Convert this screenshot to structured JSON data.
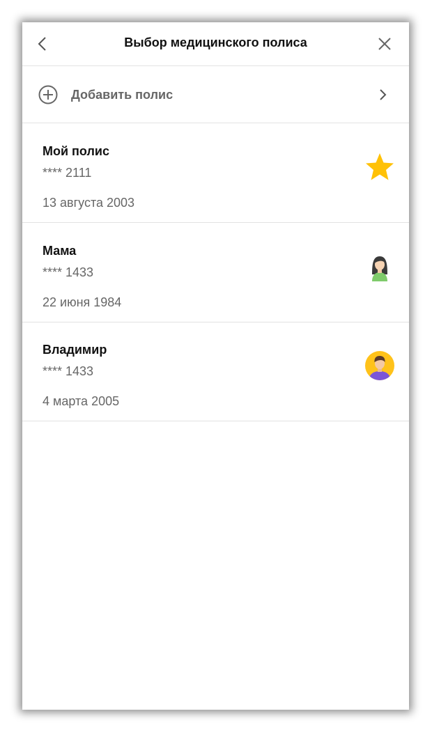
{
  "header": {
    "title": "Выбор медицинского полиса",
    "back_icon": "chevron-left-icon",
    "close_icon": "close-icon"
  },
  "add_policy": {
    "label": "Добавить полис",
    "icon": "plus-circle-icon",
    "chevron": "chevron-right-icon"
  },
  "policies": [
    {
      "name": "Мой полис",
      "number": "**** 2111",
      "date": "13 августа 2003",
      "icon": "star-icon"
    },
    {
      "name": "Мама",
      "number": "**** 1433",
      "date": "22 июня 1984",
      "icon": "woman-avatar-icon"
    },
    {
      "name": "Владимир",
      "number": "**** 1433",
      "date": "4 марта 2005",
      "icon": "man-avatar-icon"
    }
  ],
  "colors": {
    "star": "#FFC107",
    "avatar_bg": "#FFC21A",
    "shirt_woman": "#7FCB6B",
    "shirt_man": "#7B55D6"
  }
}
